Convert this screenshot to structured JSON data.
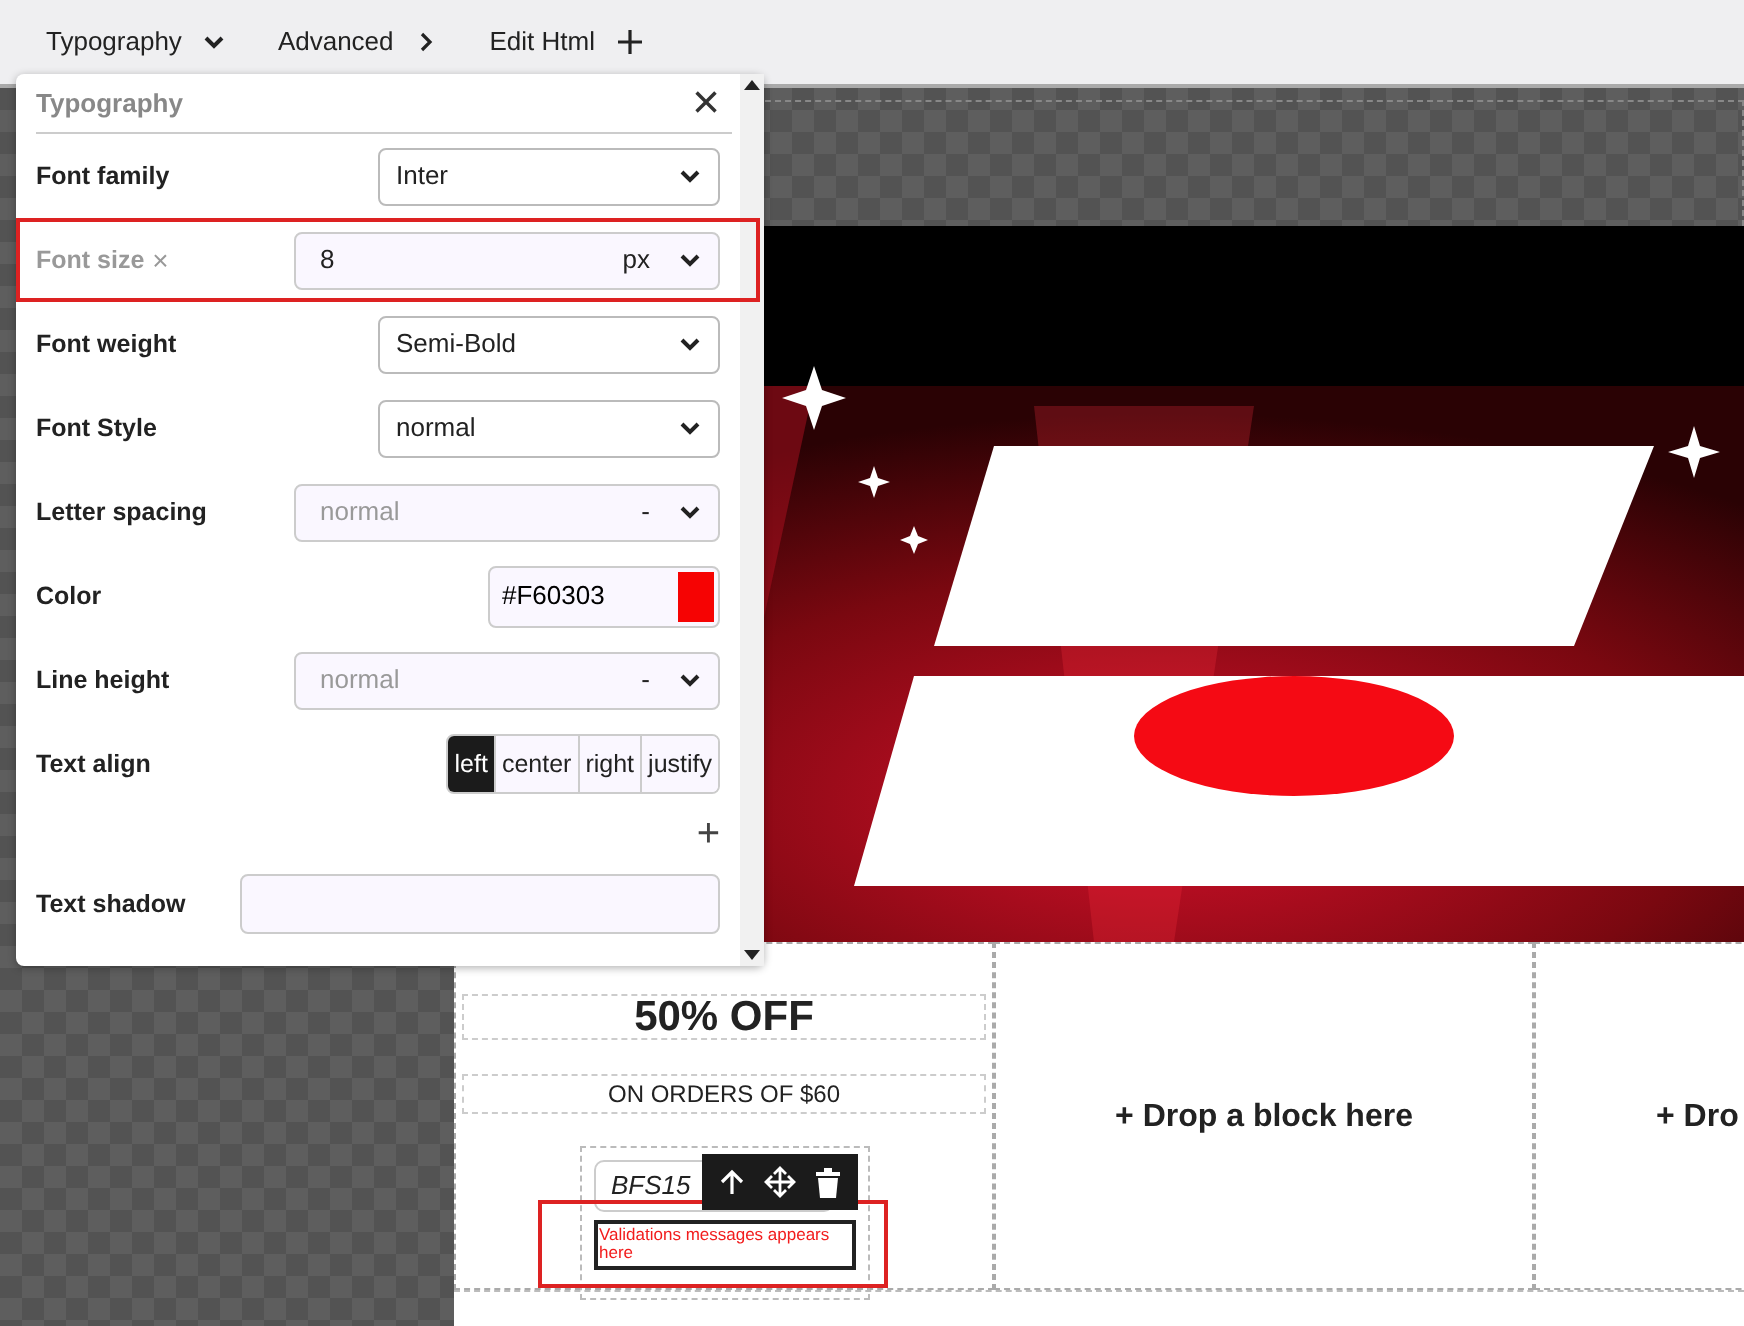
{
  "toolbar": {
    "tabs": [
      {
        "label": "Typography",
        "kind": "dropdown"
      },
      {
        "label": "Advanced",
        "kind": "link"
      },
      {
        "label": "Edit Html",
        "kind": "add"
      }
    ]
  },
  "panel": {
    "title": "Typography",
    "close": "×",
    "fields": [
      {
        "kind": "select",
        "label": "Font family",
        "value": "Inter"
      },
      {
        "kind": "unit",
        "label": "Font size",
        "value": "8",
        "unit": "px",
        "clear": "×",
        "muted": true,
        "highlighted": true
      },
      {
        "kind": "select",
        "label": "Font weight",
        "value": "Semi-Bold"
      },
      {
        "kind": "select",
        "label": "Font Style",
        "value": "normal"
      },
      {
        "kind": "unit",
        "label": "Letter spacing",
        "placeholder": "normal",
        "unit": "-"
      },
      {
        "kind": "color",
        "label": "Color",
        "value": "#F60303",
        "color": "#f60303"
      },
      {
        "kind": "unit",
        "label": "Line height",
        "placeholder": "normal",
        "unit": "-"
      },
      {
        "kind": "segmented",
        "label": "Text align",
        "options": [
          {
            "label": "left",
            "selected": true
          },
          {
            "label": "center",
            "selected": false
          },
          {
            "label": "right",
            "selected": false
          },
          {
            "label": "justify",
            "selected": false
          }
        ]
      },
      {
        "kind": "stack",
        "label": "Text shadow",
        "add": "+"
      }
    ]
  },
  "canvas": {
    "banner": {
      "kind": "picture"
    },
    "offer": {
      "title": "50% OFF",
      "subtitle": "ON ORDERS OF $60",
      "coupon": "BFS15",
      "validation": "Validations messages appears here",
      "validation_highlighted": true
    },
    "drop_zones": [
      "+ Drop a block here",
      "+ Dro"
    ]
  }
}
